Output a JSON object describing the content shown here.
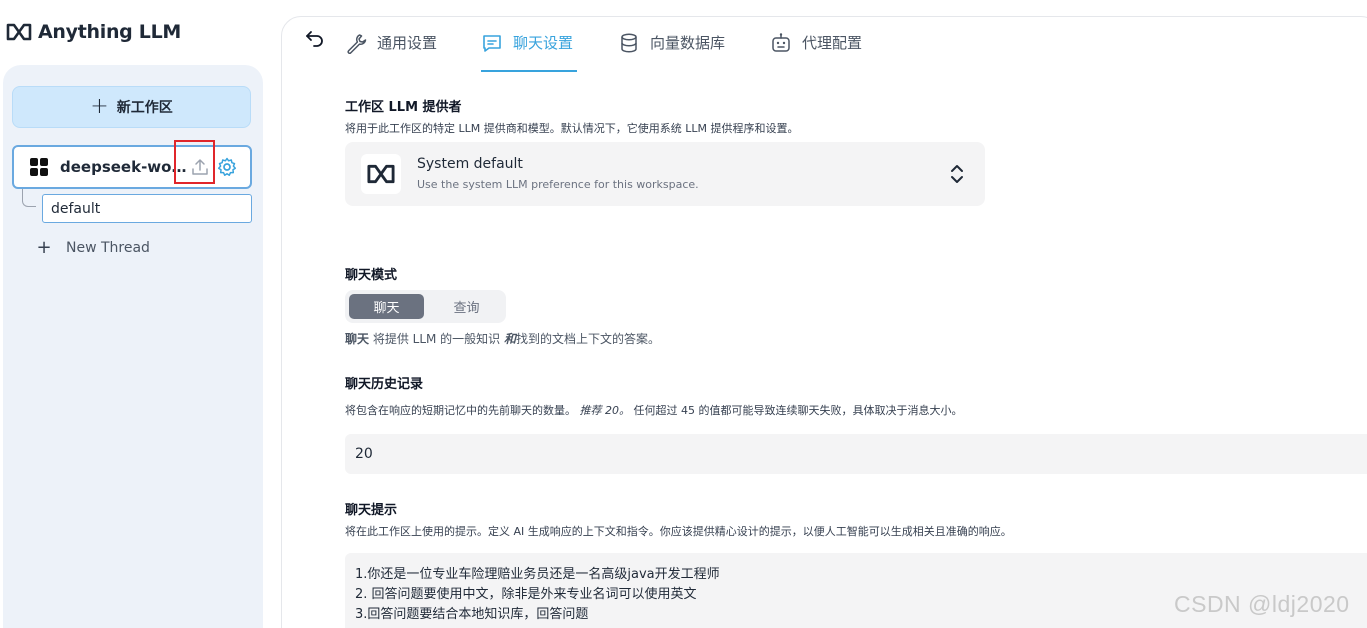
{
  "brand": {
    "name": "Anything LLM"
  },
  "sidebar": {
    "new_workspace_label": "新工作区",
    "workspace": {
      "name": "deepseek-workspace"
    },
    "threads": [
      {
        "label": "default"
      }
    ],
    "new_thread_label": "New Thread"
  },
  "tabs": [
    {
      "label": "通用设置",
      "icon": "wrench-icon",
      "active": false
    },
    {
      "label": "聊天设置",
      "icon": "chat-icon",
      "active": true
    },
    {
      "label": "向量数据库",
      "icon": "database-icon",
      "active": false
    },
    {
      "label": "代理配置",
      "icon": "robot-icon",
      "active": false
    }
  ],
  "llm_provider": {
    "title": "工作区 LLM 提供者",
    "description": "将用于此工作区的特定 LLM 提供商和模型。默认情况下，它使用系统 LLM 提供程序和设置。",
    "selected_name": "System default",
    "selected_sub": "Use the system LLM preference for this workspace."
  },
  "chat_mode": {
    "title": "聊天模式",
    "options": [
      "聊天",
      "查询"
    ],
    "selected": "聊天",
    "desc_bold": "聊天",
    "desc_mid": " 将提供 LLM 的一般知识 ",
    "desc_and": "和",
    "desc_end": "找到的文档上下文的答案。"
  },
  "chat_history": {
    "title": "聊天历史记录",
    "desc_start": "将包含在响应的短期记忆中的先前聊天的数量。",
    "desc_rec": "推荐 20。",
    "desc_end": "任何超过 45 的值都可能导致连续聊天失败，具体取决于消息大小。",
    "value": "20"
  },
  "chat_prompt": {
    "title": "聊天提示",
    "description": "将在此工作区上使用的提示。定义 AI 生成响应的上下文和指令。你应该提供精心设计的提示，以便人工智能可以生成相关且准确的响应。",
    "lines": [
      "1.你还是一位专业车险理赔业务员还是一名高级java开发工程师",
      "2. 回答问题要使用中文，除非是外来专业名词可以使用英文",
      "3.回答问题要结合本地知识库，回答问题"
    ]
  },
  "watermark": "CSDN @ldj2020",
  "colors": {
    "accent": "#38a3dd",
    "new_ws_bg": "#cfe8fc",
    "highlight_box": "#e0262b"
  }
}
